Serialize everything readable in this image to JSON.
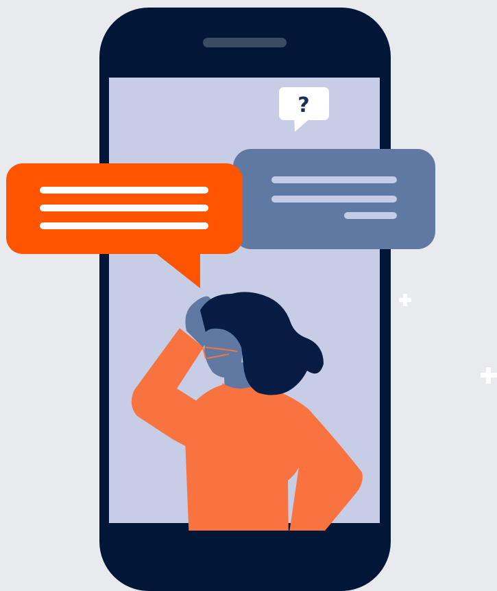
{
  "colors": {
    "background": "#E9EAEE",
    "phone_body": "#021638",
    "phone_speaker": "#3B4B64",
    "screen": "#C8CDE6",
    "speech_bubble_orange": "#FF5500",
    "speech_bubble_slate": "#5F79A2",
    "bubble_line_white": "#FFFFFF",
    "bubble_line_light": "#C5CCE6",
    "question_bubble": "#FFFFFF",
    "question_mark": "#1A2D55",
    "person_shirt": "#F97340",
    "person_hair": "#061C43",
    "person_skin": "#5F79A2",
    "glasses": "#F97340",
    "sparkle": "#FFFFFF"
  },
  "question_bubble": {
    "symbol": "?"
  },
  "icons": {
    "question": "question-mark-icon",
    "sparkle": "plus-sparkle-icon"
  }
}
